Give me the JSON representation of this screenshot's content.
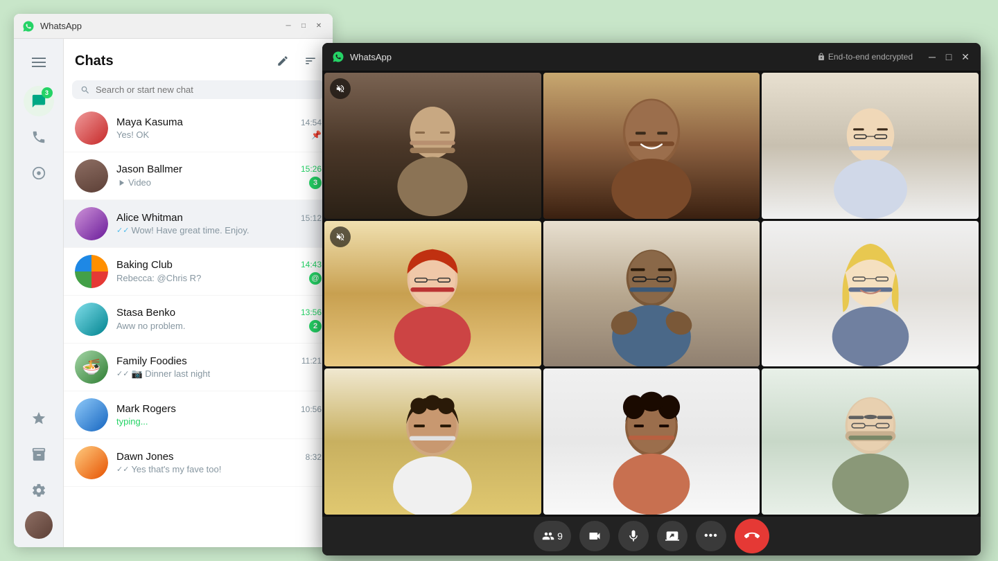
{
  "mainWindow": {
    "title": "WhatsApp",
    "titlebarControls": [
      "minimize",
      "maximize",
      "close"
    ]
  },
  "sidebar": {
    "chatsBadge": "3",
    "icons": [
      {
        "name": "menu-icon",
        "symbol": "☰"
      },
      {
        "name": "chats-icon",
        "symbol": "💬",
        "badge": "3",
        "active": true
      },
      {
        "name": "calls-icon",
        "symbol": "📞"
      },
      {
        "name": "status-icon",
        "symbol": "○"
      }
    ],
    "bottomIcons": [
      {
        "name": "starred-icon",
        "symbol": "★"
      },
      {
        "name": "archived-icon",
        "symbol": "⬒"
      },
      {
        "name": "settings-icon",
        "symbol": "⚙"
      }
    ]
  },
  "chatPanel": {
    "title": "Chats",
    "editLabel": "✏",
    "filterLabel": "≡",
    "search": {
      "placeholder": "Search or start new chat",
      "icon": "🔍"
    },
    "chats": [
      {
        "id": "maya-kasuma",
        "name": "Maya Kasuma",
        "time": "14:54",
        "preview": "Yes! OK",
        "timeClass": "normal",
        "badgeType": "pin",
        "avatarClass": "av-maya"
      },
      {
        "id": "jason-ballmer",
        "name": "Jason Ballmer",
        "time": "15:26",
        "preview": "▶ Video",
        "timeClass": "unread",
        "badgeCount": "3",
        "badgeType": "count",
        "avatarClass": "av-jason"
      },
      {
        "id": "alice-whitman",
        "name": "Alice Whitman",
        "time": "15:12",
        "preview": "✓✓ Wow! Have great time. Enjoy.",
        "timeClass": "normal",
        "badgeType": "none",
        "avatarClass": "av-alice",
        "active": true
      },
      {
        "id": "baking-club",
        "name": "Baking Club",
        "time": "14:43",
        "preview": "Rebecca: @Chris R?",
        "timeClass": "unread",
        "badgeType": "mention",
        "badgeCount": "1",
        "avatarClass": "av-baking"
      },
      {
        "id": "stasa-benko",
        "name": "Stasa Benko",
        "time": "13:56",
        "preview": "Aww no problem.",
        "timeClass": "unread",
        "badgeCount": "2",
        "badgeType": "count",
        "avatarClass": "av-stasa"
      },
      {
        "id": "family-foodies",
        "name": "Family Foodies",
        "time": "11:21",
        "preview": "✓✓ 📷 Dinner last night",
        "timeClass": "normal",
        "badgeType": "none",
        "avatarClass": "av-family"
      },
      {
        "id": "mark-rogers",
        "name": "Mark Rogers",
        "time": "10:56",
        "preview": "typing...",
        "previewClass": "typing",
        "timeClass": "normal",
        "badgeType": "none",
        "avatarClass": "av-mark"
      },
      {
        "id": "dawn-jones",
        "name": "Dawn Jones",
        "time": "8:32",
        "preview": "✓✓ Yes that's my fave too!",
        "timeClass": "normal",
        "badgeType": "none",
        "avatarClass": "av-dawn"
      }
    ]
  },
  "callWindow": {
    "title": "WhatsApp",
    "encryptionLabel": "End-to-end endcrypted",
    "controls": {
      "participantsCount": "9",
      "buttons": [
        {
          "name": "participants-button",
          "label": "👥 9"
        },
        {
          "name": "video-button",
          "label": "📹"
        },
        {
          "name": "mute-button",
          "label": "🎤"
        },
        {
          "name": "share-screen-button",
          "label": "⬆"
        },
        {
          "name": "more-button",
          "label": "•••"
        },
        {
          "name": "end-call-button",
          "label": "📞"
        }
      ]
    },
    "grid": [
      {
        "id": 1,
        "muted": true
      },
      {
        "id": 2,
        "muted": false
      },
      {
        "id": 3,
        "muted": false
      },
      {
        "id": 4,
        "muted": true
      },
      {
        "id": 5,
        "muted": false,
        "highlighted": true
      },
      {
        "id": 6,
        "muted": false
      },
      {
        "id": 7,
        "muted": false
      },
      {
        "id": 8,
        "muted": false
      },
      {
        "id": 9,
        "muted": false
      }
    ]
  }
}
